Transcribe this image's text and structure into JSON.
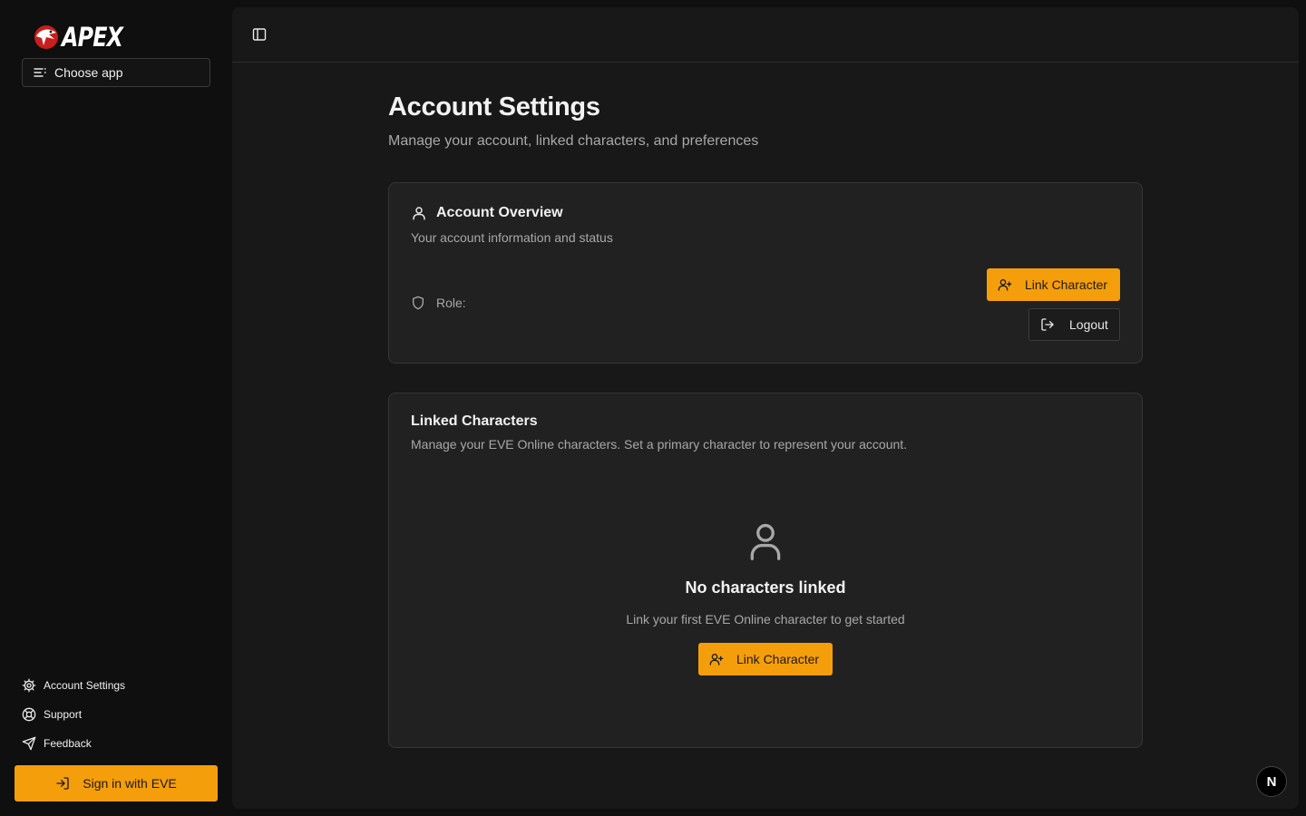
{
  "brand": {
    "logo_text": "APEX",
    "accent_color": "#f59e0b"
  },
  "sidebar": {
    "choose_app_label": "Choose app",
    "items": [
      {
        "label": "Account Settings",
        "icon": "gear-icon"
      },
      {
        "label": "Support",
        "icon": "lifebuoy-icon"
      },
      {
        "label": "Feedback",
        "icon": "send-icon"
      }
    ],
    "signin_label": "Sign in with EVE"
  },
  "page": {
    "title": "Account Settings",
    "subtitle": "Manage your account, linked characters, and preferences"
  },
  "overview": {
    "title": "Account Overview",
    "description": "Your account information and status",
    "role_label": "Role:",
    "link_button": "Link Character",
    "logout_button": "Logout"
  },
  "linked": {
    "title": "Linked Characters",
    "description": "Manage your EVE Online characters. Set a primary character to represent your account.",
    "empty_title": "No characters linked",
    "empty_subtitle": "Link your first EVE Online character to get started",
    "link_button": "Link Character"
  },
  "badge": {
    "label": "N"
  }
}
